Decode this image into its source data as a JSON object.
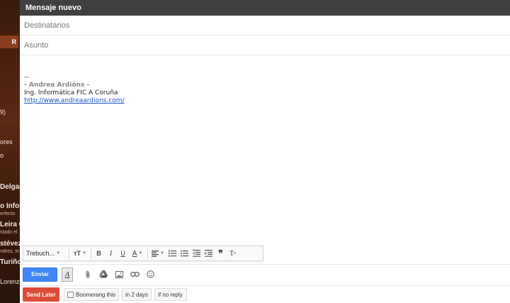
{
  "background": {
    "button_label": "R",
    "items": [
      {
        "text": "9)",
        "bold": false
      },
      {
        "text": "ores",
        "bold": false
      },
      {
        "text": "o",
        "bold": false
      },
      {
        "text": "Delgado",
        "bold": true
      },
      {
        "text": "o Infor",
        "bold": true
      },
      {
        "text": "erfecto",
        "bold": false
      },
      {
        "text": "Leira Ca",
        "bold": true
      },
      {
        "text": "stado el",
        "bold": false
      },
      {
        "text": "stévez",
        "bold": true
      },
      {
        "text": "ndres, te",
        "bold": false
      },
      {
        "text": "Turiño",
        "bold": true
      },
      {
        "text": "Lorenz",
        "bold": false
      }
    ]
  },
  "compose": {
    "title": "Mensaje nuevo",
    "to_placeholder": "Destinatarios",
    "subject_placeholder": "Asunto",
    "signature": {
      "separator": "--",
      "name": "- Andrea Ardións -",
      "line2": "Ing. Informática FIC A Coruña",
      "link": "http://www.andreaardions.com/"
    }
  },
  "toolbar": {
    "font_name": "Trebuch...",
    "size_label": "тT",
    "bold": "B",
    "italic": "I",
    "underline": "U",
    "text_color": "A",
    "quote": "❞",
    "clear_format": "T"
  },
  "actions": {
    "send_label": "Enviar",
    "format_label": "A"
  },
  "boomerang": {
    "send_later_label": "Send Later",
    "boomerang_label": "Boomerang this",
    "delay": "in 2 days",
    "condition": "if no reply"
  },
  "colors": {
    "send": "#4285f4",
    "send_later": "#dd4b39",
    "header": "#404040",
    "link": "#1a55c6"
  }
}
